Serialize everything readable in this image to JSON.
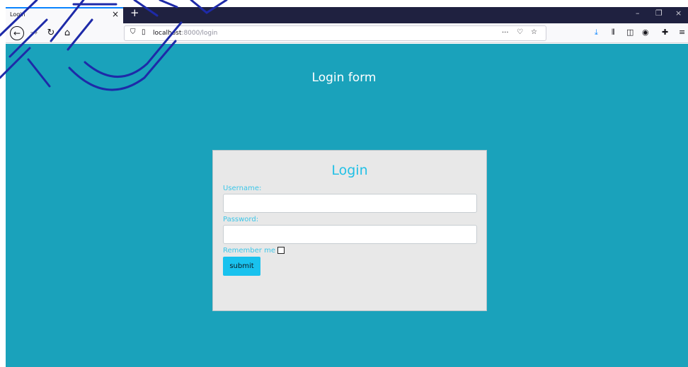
{
  "browser": {
    "tab_title": "Login",
    "tab_close": "×",
    "new_tab": "+",
    "url_host": "localhost",
    "url_rest": ":8000/login",
    "page_actions": "···",
    "window_controls": {
      "minimize": "–",
      "restore": "❐",
      "close": "×"
    }
  },
  "page": {
    "heading": "Login form"
  },
  "login_card": {
    "title": "Login",
    "username_label": "Username:",
    "username_value": "",
    "password_label": "Password:",
    "password_value": "",
    "remember_label": "Remember me",
    "remember_checked": false,
    "submit_label": "submit"
  },
  "colors": {
    "background": "#1aa2bb",
    "card": "#e8e8e8",
    "accent": "#19c2ee",
    "label": "#3cc6e8"
  }
}
